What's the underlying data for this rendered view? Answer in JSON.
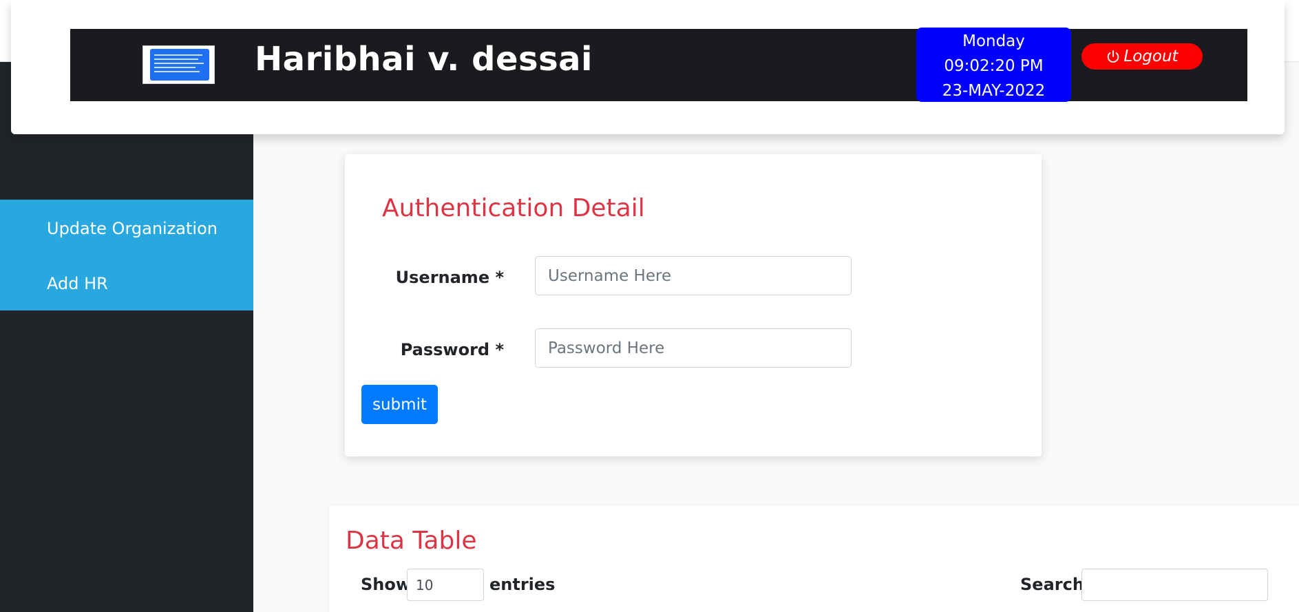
{
  "header": {
    "title": "Haribhai v. dessai",
    "datetime": {
      "day": "Monday",
      "time": "09:02:20 PM",
      "date": "23-MAY-2022"
    },
    "logout_label": "Logout",
    "logo_icon": "logo-image"
  },
  "sidebar": {
    "items": [
      {
        "label": "Update Organization"
      },
      {
        "label": "Add HR"
      }
    ]
  },
  "auth_form": {
    "heading": "Authentication Detail",
    "username_label": "Username *",
    "username_placeholder": "Username Here",
    "password_label": "Password *",
    "password_placeholder": "Password Here",
    "submit_label": "submit"
  },
  "data_table": {
    "heading": "Data Table",
    "show_label": "Show",
    "entries_value": "10",
    "entries_label": "entries",
    "search_label": "Search:"
  },
  "colors": {
    "sidebar_bg": "#212529",
    "sidebar_menu_bg": "#29a8e0",
    "datetime_bg": "#0000ff",
    "logout_bg": "#ff0000",
    "heading_red": "#dc3545",
    "submit_blue": "#007bff"
  }
}
